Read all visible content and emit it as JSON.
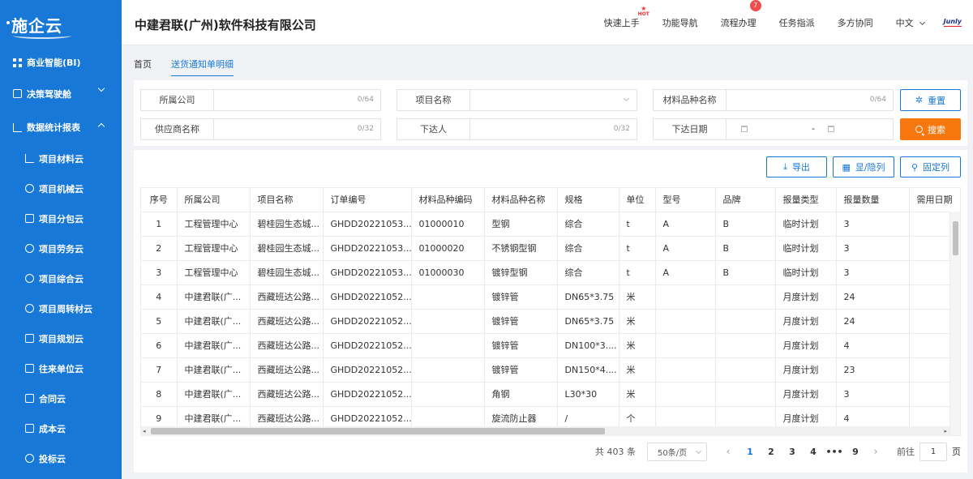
{
  "sidebar": {
    "logo": "施企云",
    "items": [
      {
        "label": "商业智能(BI)",
        "icon": "grid-icon"
      },
      {
        "label": "决策驾驶舱",
        "icon": "grid-outline-icon"
      },
      {
        "label": "数据统计报表",
        "icon": "report-icon"
      }
    ],
    "subitems": [
      {
        "label": "项目材料云",
        "icon": "material-icon"
      },
      {
        "label": "项目机械云",
        "icon": "gear-icon"
      },
      {
        "label": "项目分包云",
        "icon": "box-icon"
      },
      {
        "label": "项目劳务云",
        "icon": "worker-icon"
      },
      {
        "label": "项目综合云",
        "icon": "comprehensive-icon"
      },
      {
        "label": "项目周转材云",
        "icon": "cycle-icon"
      },
      {
        "label": "项目规划云",
        "icon": "plan-icon"
      },
      {
        "label": "往来单位云",
        "icon": "building-icon"
      },
      {
        "label": "合同云",
        "icon": "contract-icon"
      },
      {
        "label": "成本云",
        "icon": "layers-icon"
      },
      {
        "label": "投标云",
        "icon": "bid-icon"
      }
    ]
  },
  "header": {
    "company": "中建君联(广州)软件科技有限公司",
    "nav": [
      "快速上手",
      "功能导航",
      "流程办理",
      "任务指派",
      "多方协同"
    ],
    "hot_label": "HOT",
    "process_badge": "7",
    "language": "中文",
    "brand": "Junly"
  },
  "tabs": [
    {
      "label": "首页"
    },
    {
      "label": "送货通知单明细"
    }
  ],
  "filter": {
    "company": {
      "label": "所属公司",
      "count": "0/64"
    },
    "project": {
      "label": "项目名称"
    },
    "material": {
      "label": "材料品种名称",
      "count": "0/64"
    },
    "supplier": {
      "label": "供应商名称",
      "count": "0/32"
    },
    "issuer": {
      "label": "下达人",
      "count": "0/32"
    },
    "date": {
      "label": "下达日期",
      "separator": "-"
    },
    "reset_label": "重置",
    "search_label": "搜索"
  },
  "toolbar": {
    "export": "导出",
    "toggle_cols": "显/隐列",
    "fix_cols": "固定列"
  },
  "table": {
    "columns": [
      "序号",
      "所属公司",
      "项目名称",
      "订单编号",
      "材料品种编码",
      "材料品种名称",
      "规格",
      "单位",
      "型号",
      "品牌",
      "报量类型",
      "报量数量",
      "需用日期"
    ],
    "rows": [
      [
        "1",
        "工程管理中心",
        "碧桂园生态城...",
        "GHDD20221053...",
        "01000010",
        "型钢",
        "综合",
        "t",
        "A",
        "B",
        "临时计划",
        "3",
        ""
      ],
      [
        "2",
        "工程管理中心",
        "碧桂园生态城...",
        "GHDD20221053...",
        "01000020",
        "不锈钢型钢",
        "综合",
        "t",
        "A",
        "B",
        "临时计划",
        "3",
        ""
      ],
      [
        "3",
        "工程管理中心",
        "碧桂园生态城...",
        "GHDD20221053...",
        "01000030",
        "镀锌型钢",
        "综合",
        "t",
        "A",
        "B",
        "临时计划",
        "3",
        ""
      ],
      [
        "4",
        "中建君联(广...",
        "西藏班达公路...",
        "GHDD20221052...",
        "",
        "镀锌管",
        "DN65*3.75",
        "米",
        "",
        "",
        "月度计划",
        "24",
        ""
      ],
      [
        "5",
        "中建君联(广...",
        "西藏班达公路...",
        "GHDD20221052...",
        "",
        "镀锌管",
        "DN65*3.75",
        "米",
        "",
        "",
        "月度计划",
        "24",
        ""
      ],
      [
        "6",
        "中建君联(广...",
        "西藏班达公路...",
        "GHDD20221052...",
        "",
        "镀锌管",
        "DN100*3....",
        "米",
        "",
        "",
        "月度计划",
        "4",
        ""
      ],
      [
        "7",
        "中建君联(广...",
        "西藏班达公路...",
        "GHDD20221052...",
        "",
        "镀锌管",
        "DN150*4....",
        "米",
        "",
        "",
        "月度计划",
        "23",
        ""
      ],
      [
        "8",
        "中建君联(广...",
        "西藏班达公路...",
        "GHDD20221052...",
        "",
        "角钢",
        "L30*30",
        "米",
        "",
        "",
        "月度计划",
        "3",
        ""
      ],
      [
        "9",
        "中建君联(广...",
        "西藏班达公路...",
        "GHDD20221052...",
        "",
        "旋流防止器",
        "/",
        "个",
        "",
        "",
        "月度计划",
        "4",
        ""
      ]
    ]
  },
  "pagination": {
    "total": "共 403 条",
    "page_size": "50条/页",
    "pages": [
      "1",
      "2",
      "3",
      "4",
      "•••",
      "9"
    ],
    "current": "1",
    "goto_label": "前往",
    "goto_value": "1",
    "page_unit": "页"
  }
}
